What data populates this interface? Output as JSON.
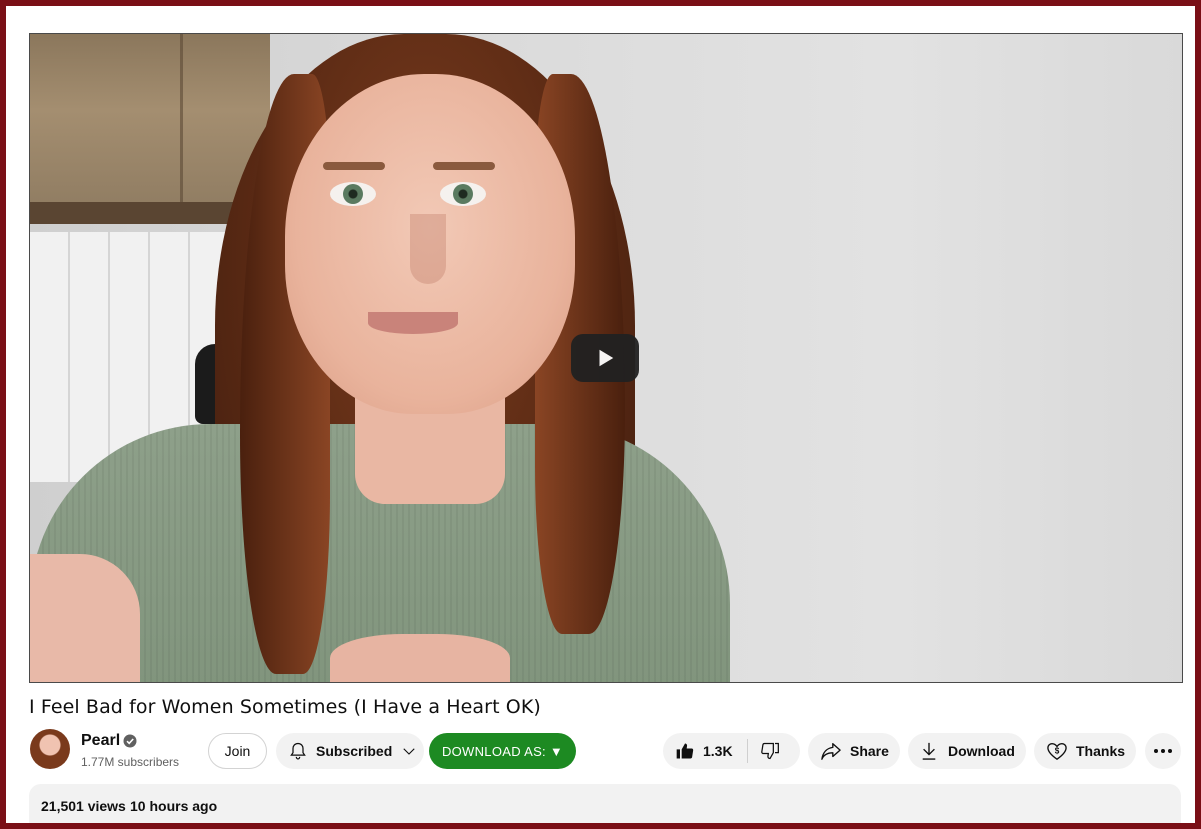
{
  "video": {
    "play_icon": "play-icon"
  },
  "title": "I Feel Bad for Women Sometimes (I Have a Heart OK)",
  "channel": {
    "name": "Pearl",
    "subscribers": "1.77M subscribers",
    "verified_icon": "verified-check-icon"
  },
  "actions": {
    "join": "Join",
    "subscribed": "Subscribed",
    "download_as": "DOWNLOAD AS: ▼",
    "likes": "1.3K",
    "share": "Share",
    "download": "Download",
    "thanks": "Thanks"
  },
  "description": {
    "views": "21,501 views",
    "time_ago": "10 hours ago"
  },
  "colors": {
    "frame_border": "#7a0f16",
    "download_as_bg": "#1d8a22",
    "pill_bg": "#f2f2f2"
  }
}
